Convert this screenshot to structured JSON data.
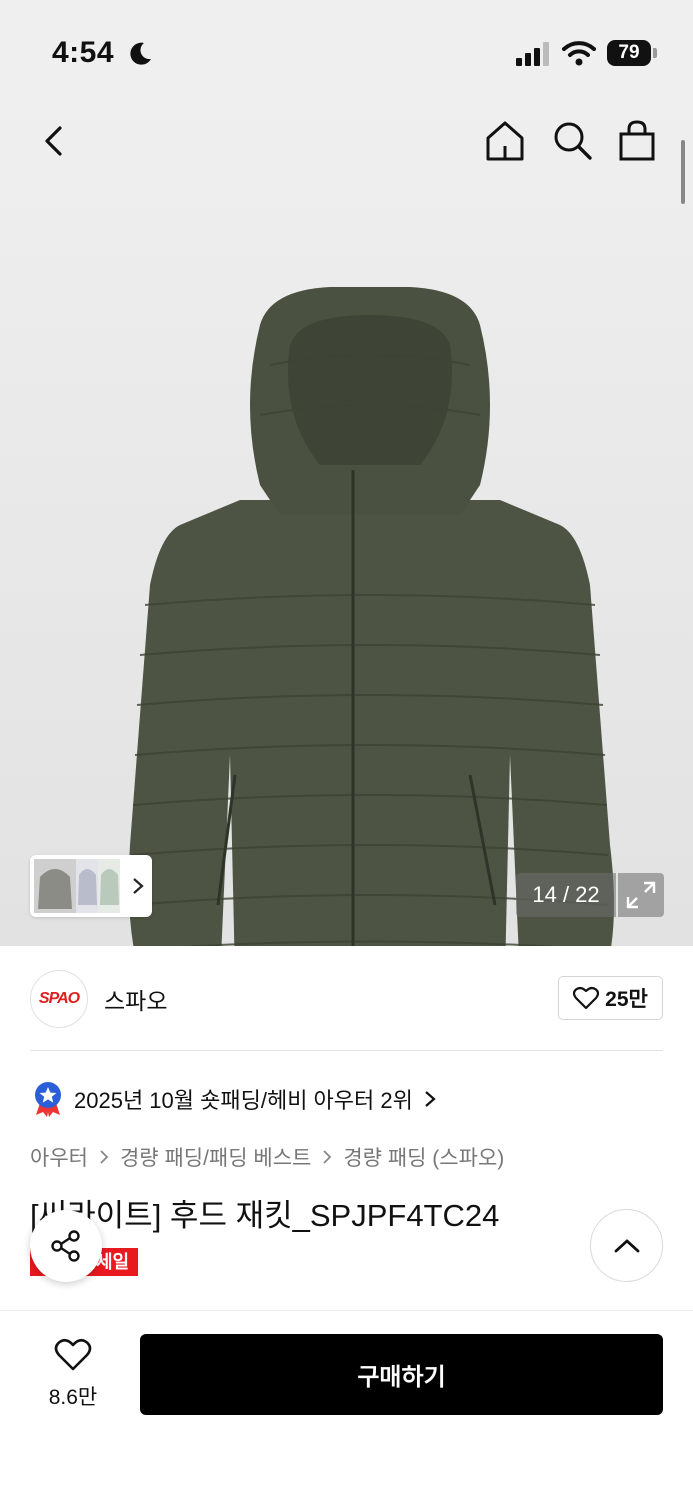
{
  "status_bar": {
    "time": "4:54",
    "battery": "79"
  },
  "gallery": {
    "counter": "14 / 22"
  },
  "brand": {
    "logo_text": "SPAO",
    "name": "스파오",
    "likes": "25만"
  },
  "ranking": {
    "text": "2025년 10월 숏패딩/헤비 아우터 2위"
  },
  "breadcrumb": [
    "아우터",
    "경량 패딩/패딩 베스트",
    "경량 패딩 (스파오)"
  ],
  "product": {
    "title": "[씨라이트] 후드 재킷_SPJPF4TC24",
    "badge": "세일"
  },
  "bottom_bar": {
    "wish_count": "8.6만",
    "buy_label": "구매하기"
  },
  "colors": {
    "jacket": "#4d5443",
    "sale": "#e8191f",
    "buy_bg": "#000000"
  },
  "icons": [
    "moon-icon",
    "signal-icon",
    "wifi-icon",
    "back-icon",
    "home-icon",
    "search-icon",
    "bag-icon",
    "expand-icon",
    "heart-icon",
    "medal-icon",
    "chevron-right-icon",
    "share-icon",
    "chevron-up-icon"
  ]
}
